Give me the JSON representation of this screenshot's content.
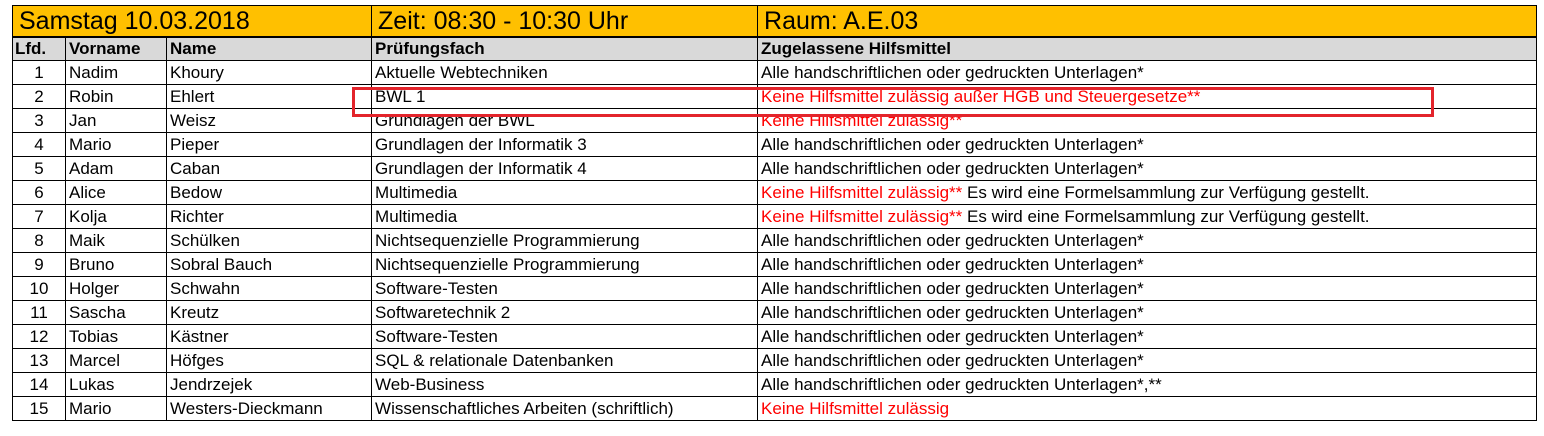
{
  "header": {
    "date": "Samstag 10.03.2018",
    "time": "Zeit: 08:30 - 10:30 Uhr",
    "room": "Raum: A.E.03"
  },
  "columns": [
    "Lfd.",
    "Vorname",
    "Name",
    "Prüfungsfach",
    "Zugelassene Hilfsmittel"
  ],
  "rows": [
    {
      "nr": "1",
      "vorname": "Nadim",
      "name": "Khoury",
      "fach": "Aktuelle Webtechniken",
      "hilfsmittel_red": "",
      "hilfsmittel": "Alle handschriftlichen oder gedruckten Unterlagen*"
    },
    {
      "nr": "2",
      "vorname": "Robin",
      "name": "Ehlert",
      "fach": "BWL 1",
      "hilfsmittel_red": "Keine Hilfsmittel zulässig außer HGB und Steuergesetze**",
      "hilfsmittel": ""
    },
    {
      "nr": "3",
      "vorname": "Jan",
      "name": "Weisz",
      "fach": "Grundlagen der BWL",
      "hilfsmittel_red": "Keine Hilfsmittel zulässig**",
      "hilfsmittel": ""
    },
    {
      "nr": "4",
      "vorname": "Mario",
      "name": "Pieper",
      "fach": "Grundlagen der Informatik 3",
      "hilfsmittel_red": "",
      "hilfsmittel": "Alle handschriftlichen oder gedruckten Unterlagen*"
    },
    {
      "nr": "5",
      "vorname": "Adam",
      "name": "Caban",
      "fach": "Grundlagen der Informatik 4",
      "hilfsmittel_red": "",
      "hilfsmittel": "Alle handschriftlichen oder gedruckten Unterlagen*"
    },
    {
      "nr": "6",
      "vorname": "Alice",
      "name": "Bedow",
      "fach": "Multimedia",
      "hilfsmittel_red": "Keine Hilfsmittel zulässig**",
      "hilfsmittel": " Es wird eine Formelsammlung zur Verfügung gestellt."
    },
    {
      "nr": "7",
      "vorname": "Kolja",
      "name": "Richter",
      "fach": "Multimedia",
      "hilfsmittel_red": "Keine Hilfsmittel zulässig**",
      "hilfsmittel": " Es wird eine Formelsammlung zur Verfügung gestellt."
    },
    {
      "nr": "8",
      "vorname": "Maik",
      "name": "Schülken",
      "fach": "Nichtsequenzielle Programmierung",
      "hilfsmittel_red": "",
      "hilfsmittel": "Alle handschriftlichen oder gedruckten Unterlagen*"
    },
    {
      "nr": "9",
      "vorname": "Bruno",
      "name": "Sobral Bauch",
      "fach": "Nichtsequenzielle Programmierung",
      "hilfsmittel_red": "",
      "hilfsmittel": "Alle handschriftlichen oder gedruckten Unterlagen*"
    },
    {
      "nr": "10",
      "vorname": "Holger",
      "name": "Schwahn",
      "fach": "Software-Testen",
      "hilfsmittel_red": "",
      "hilfsmittel": "Alle handschriftlichen oder gedruckten Unterlagen*"
    },
    {
      "nr": "11",
      "vorname": "Sascha",
      "name": "Kreutz",
      "fach": "Softwaretechnik 2",
      "hilfsmittel_red": "",
      "hilfsmittel": "Alle handschriftlichen oder gedruckten Unterlagen*"
    },
    {
      "nr": "12",
      "vorname": "Tobias",
      "name": "Kästner",
      "fach": "Software-Testen",
      "hilfsmittel_red": "",
      "hilfsmittel": "Alle handschriftlichen oder gedruckten Unterlagen*"
    },
    {
      "nr": "13",
      "vorname": "Marcel",
      "name": "Höfges",
      "fach": "SQL & relationale Datenbanken",
      "hilfsmittel_red": "",
      "hilfsmittel": "Alle handschriftlichen oder gedruckten Unterlagen*"
    },
    {
      "nr": "14",
      "vorname": "Lukas",
      "name": "Jendrzejek",
      "fach": "Web-Business",
      "hilfsmittel_red": "",
      "hilfsmittel": "Alle handschriftlichen oder gedruckten Unterlagen*,**"
    },
    {
      "nr": "15",
      "vorname": "Mario",
      "name": "Westers-Dieckmann",
      "fach": "Wissenschaftliches Arbeiten (schriftlich)",
      "hilfsmittel_red": "Keine Hilfsmittel zulässig",
      "hilfsmittel": ""
    }
  ],
  "colors": {
    "header_bg": "#ffc000",
    "column_header_bg": "#d9d9d9",
    "warning_text": "#ff0000",
    "highlight_box": "#e3242b"
  }
}
